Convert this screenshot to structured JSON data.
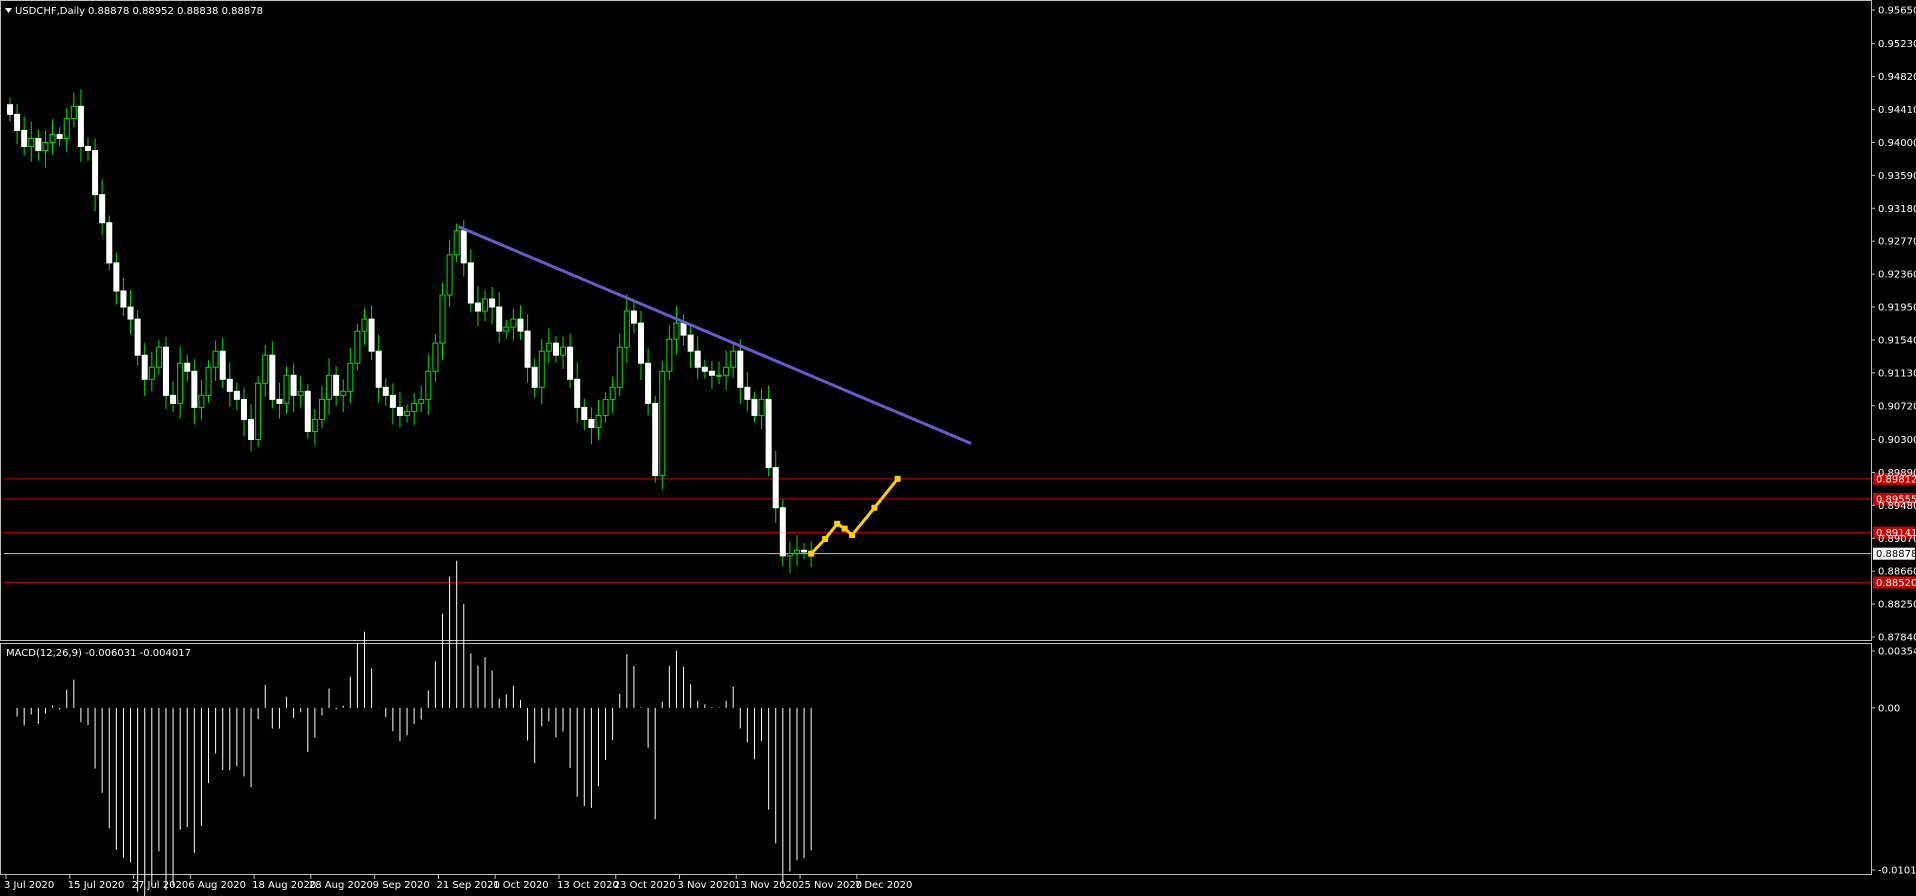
{
  "header": {
    "symbol": "USDCHF,Daily",
    "ohlc": "0.88878 0.88952 0.88838 0.88878"
  },
  "macd_header": "MACD(12,26,9) -0.006031 -0.004017",
  "colors": {
    "background": "#000000",
    "bull_candle": "#ffffff",
    "bear_wick": "#00e000",
    "trendline": "#6a5acd",
    "support_lines": "#cc0000",
    "current_line": "#c0c0c0",
    "projection": "#ffd000",
    "macd_bars": "#ffffff"
  },
  "chart_data": [
    {
      "type": "candlestick",
      "title": "USDCHF,Daily",
      "x_tick_labels": [
        "3 Jul 2020",
        "15 Jul 2020",
        "27 Jul 2020",
        "6 Aug 2020",
        "18 Aug 2020",
        "28 Aug 2020",
        "9 Sep 2020",
        "21 Sep 2020",
        "1 Oct 2020",
        "13 Oct 2020",
        "23 Oct 2020",
        "3 Nov 2020",
        "13 Nov 2020",
        "25 Nov 2020",
        "7 Dec 2020"
      ],
      "y_tick_labels": [
        "0.95650",
        "0.95230",
        "0.94820",
        "0.94410",
        "0.94000",
        "0.93590",
        "0.93180",
        "0.92770",
        "0.92360",
        "0.91950",
        "0.91540",
        "0.91130",
        "0.90720",
        "0.90300",
        "0.89890",
        "0.89480",
        "0.89070",
        "0.88660",
        "0.88250",
        "0.87840"
      ],
      "ylim": [
        0.8784,
        0.9565
      ],
      "close_series": [
        0.9435,
        0.9415,
        0.9395,
        0.9405,
        0.939,
        0.94,
        0.941,
        0.9405,
        0.943,
        0.9445,
        0.9395,
        0.939,
        0.9335,
        0.93,
        0.925,
        0.9215,
        0.9195,
        0.918,
        0.9135,
        0.9105,
        0.912,
        0.9145,
        0.9085,
        0.9075,
        0.9125,
        0.9115,
        0.907,
        0.9085,
        0.912,
        0.914,
        0.9105,
        0.909,
        0.908,
        0.9055,
        0.903,
        0.91,
        0.9135,
        0.908,
        0.9075,
        0.911,
        0.9085,
        0.909,
        0.904,
        0.9055,
        0.908,
        0.911,
        0.9085,
        0.909,
        0.9125,
        0.9165,
        0.918,
        0.914,
        0.9095,
        0.9085,
        0.907,
        0.906,
        0.9065,
        0.9075,
        0.908,
        0.9115,
        0.915,
        0.921,
        0.926,
        0.929,
        0.925,
        0.92,
        0.919,
        0.9205,
        0.9195,
        0.9165,
        0.917,
        0.918,
        0.9165,
        0.912,
        0.9095,
        0.914,
        0.915,
        0.9135,
        0.9145,
        0.9105,
        0.907,
        0.9055,
        0.9045,
        0.906,
        0.908,
        0.9095,
        0.9145,
        0.919,
        0.9175,
        0.9125,
        0.9075,
        0.8985,
        0.9115,
        0.9155,
        0.9175,
        0.916,
        0.914,
        0.912,
        0.9115,
        0.911,
        0.911,
        0.912,
        0.914,
        0.9095,
        0.908,
        0.906,
        0.908,
        0.8995,
        0.8945,
        0.8885,
        0.8888,
        0.8892,
        0.889,
        0.8888
      ],
      "horizontal_levels": {
        "red_1": 0.8981,
        "red_2": 0.8956,
        "red_3": 0.8914,
        "current": 0.88878,
        "red_4": 0.8852
      },
      "level_labels": {
        "red_1": "0.89812",
        "red_2": "0.89555",
        "red_3": "0.89141",
        "current": "0.88878",
        "red_4": "0.88520"
      },
      "trendline": {
        "from": [
          "23 Sep 2020",
          0.9295
        ],
        "to": [
          "7 Jan 2021",
          0.9025
        ]
      },
      "projection": [
        0.88878,
        0.8906,
        0.8925,
        0.8919,
        0.8911,
        0.8945,
        0.8981
      ]
    },
    {
      "type": "bar",
      "title": "MACD(12,26,9) -0.006031 -0.004017",
      "y_tick_labels": [
        "0.003546",
        "0.00",
        "-0.010118"
      ],
      "ylim": [
        -0.010118,
        0.003546
      ]
    }
  ]
}
